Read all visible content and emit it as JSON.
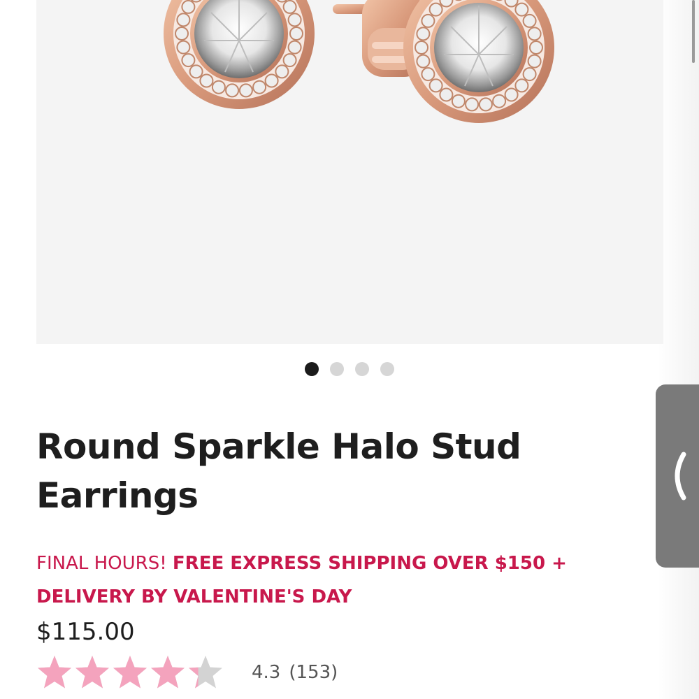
{
  "gallery": {
    "slides_total": 4,
    "active_slide": 1,
    "next_icon": "chevron-right-icon"
  },
  "side_tab": {
    "icon": "chevron-left-icon"
  },
  "product": {
    "title": "Round Sparkle Halo Stud Earrings",
    "promo_lead": "FINAL HOURS!",
    "promo_main": "FREE EXPRESS SHIPPING OVER $150 + DELIVERY BY VALENTINE'S DAY",
    "price": "$115.00",
    "rating": {
      "value": "4.3",
      "count": "(153)",
      "stars_fraction": 0.86
    }
  },
  "colors": {
    "promo": "#c8184c",
    "star_filled": "#f4a3bd",
    "star_empty": "#d3d3d3",
    "text": "#1e1e1e",
    "gallery_bg": "#f4f4f4"
  }
}
